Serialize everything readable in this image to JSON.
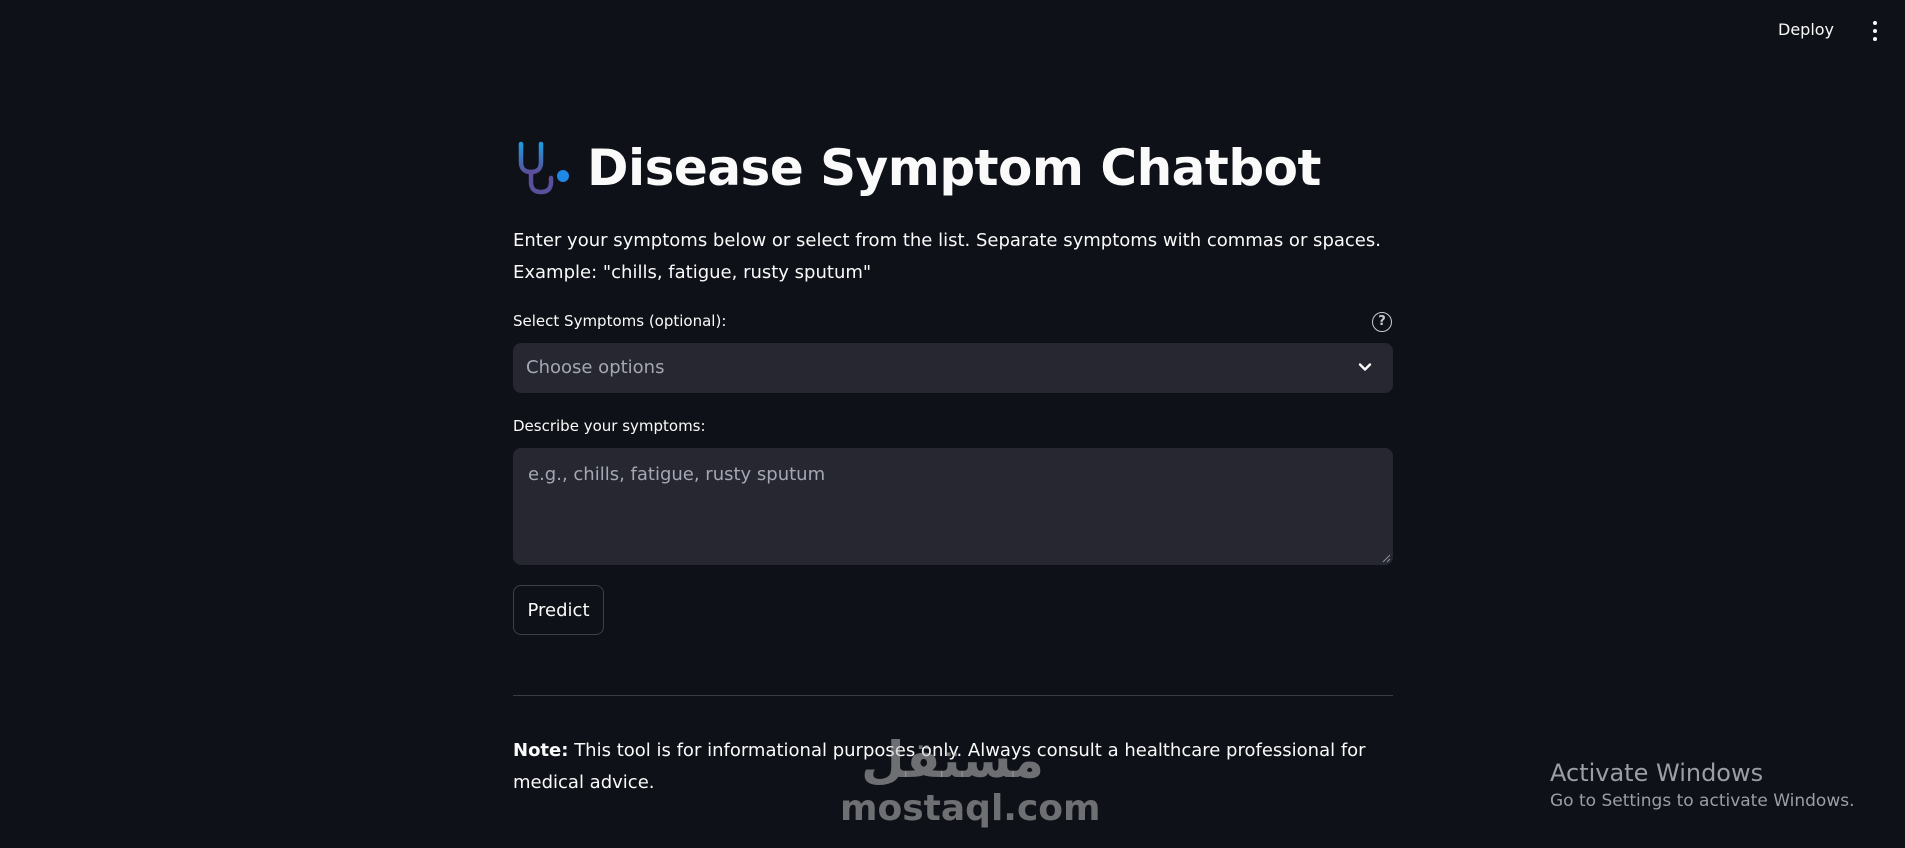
{
  "header": {
    "deploy_label": "Deploy",
    "menu_icon": "kebab-menu-icon"
  },
  "main": {
    "title_icon": "stethoscope-icon",
    "title": "Disease Symptom Chatbot",
    "intro": "Enter your symptoms below or select from the list. Separate symptoms with commas or spaces. Example: \"chills, fatigue, rusty sputum\"",
    "select": {
      "label": "Select Symptoms (optional):",
      "placeholder": "Choose options",
      "help_icon": "help-icon"
    },
    "describe": {
      "label": "Describe your symptoms:",
      "placeholder": "e.g., chills, fatigue, rusty sputum"
    },
    "predict_label": "Predict",
    "note_prefix": "Note:",
    "note_text": "This tool is for informational purposes only. Always consult a healthcare professional for medical advice."
  },
  "watermark": {
    "arabic": "مستقل",
    "latin": "mostaql.com"
  },
  "os_overlay": {
    "title": "Activate Windows",
    "subtitle": "Go to Settings to activate Windows."
  },
  "colors": {
    "background": "#0e1117",
    "input_bg": "#262730",
    "icon_blue": "#1e88e5",
    "icon_purple": "#5b5b9a"
  }
}
